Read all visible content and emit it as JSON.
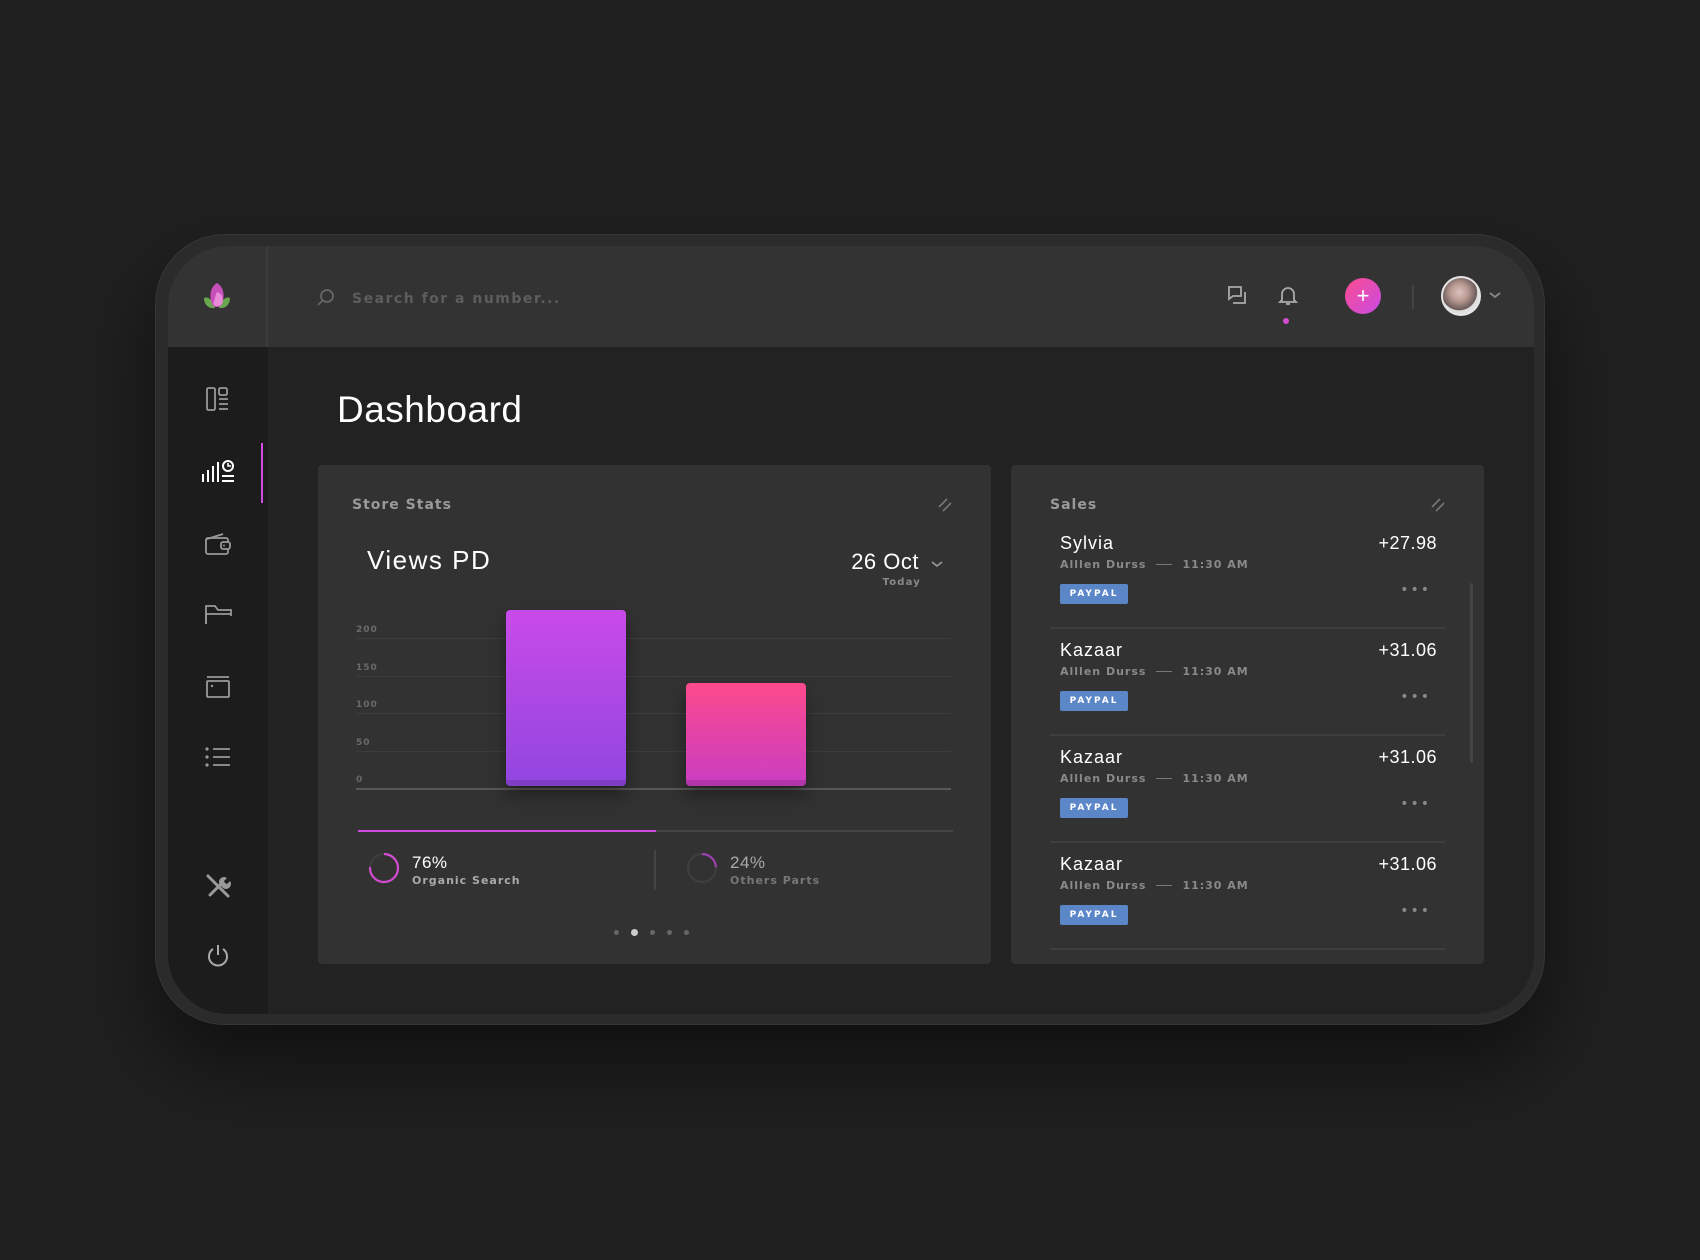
{
  "app": {
    "brand_icon": "lotus-bud-logo"
  },
  "header": {
    "search": {
      "placeholder": "Search for a number...",
      "value": ""
    },
    "icons": [
      "search-icon",
      "messages-icon",
      "bell-icon",
      "plus-icon",
      "avatar",
      "chevron-down-icon"
    ],
    "add_label": "+",
    "notification_dot_color": "#d54bd2"
  },
  "sidebar": {
    "items": [
      {
        "icon": "layout-icon",
        "active": false
      },
      {
        "icon": "analytics-icon",
        "active": true
      },
      {
        "icon": "wallet-icon",
        "active": false
      },
      {
        "icon": "folder-icon",
        "active": false
      },
      {
        "icon": "browser-window-icon",
        "active": false
      },
      {
        "icon": "list-icon",
        "active": false
      },
      {
        "icon": "tools-icon",
        "active": false
      },
      {
        "icon": "power-icon",
        "active": false
      }
    ],
    "accent": "#d04be0"
  },
  "page": {
    "title": "Dashboard"
  },
  "store_stats": {
    "title": "Store Stats",
    "metric": "Views PD",
    "date": "26 Oct",
    "date_sub": "Today",
    "progress_fraction": 0.5,
    "stats": [
      {
        "value": "76%",
        "label": "Organic Search",
        "fraction": 0.76,
        "color": "#d54bd2"
      },
      {
        "value": "24%",
        "label": "Others Parts",
        "fraction": 0.24,
        "color": "#9c3fb0"
      }
    ],
    "pagination": {
      "count": 5,
      "active": 1
    }
  },
  "chart_data": {
    "type": "bar",
    "title": "Views PD",
    "categories": [
      "Organic Search",
      "Others Parts"
    ],
    "values": [
      235,
      138
    ],
    "colors": [
      [
        "#c94ae8",
        "#9146e0"
      ],
      [
        "#fd4a8c",
        "#c93dc3"
      ]
    ],
    "yticks": [
      0,
      50,
      100,
      150,
      200
    ],
    "ylim": [
      0,
      200
    ],
    "xlabel": "",
    "ylabel": "",
    "grid": true
  },
  "sales": {
    "title": "Sales",
    "items": [
      {
        "name": "Sylvia",
        "amount": "+27.98",
        "customer": "Alllen Durss",
        "time": "11:30 AM",
        "method": "PAYPAL"
      },
      {
        "name": "Kazaar",
        "amount": "+31.06",
        "customer": "Alllen Durss",
        "time": "11:30 AM",
        "method": "PAYPAL"
      },
      {
        "name": "Kazaar",
        "amount": "+31.06",
        "customer": "Alllen Durss",
        "time": "11:30 AM",
        "method": "PAYPAL"
      },
      {
        "name": "Kazaar",
        "amount": "+31.06",
        "customer": "Alllen Durss",
        "time": "11:30 AM",
        "method": "PAYPAL"
      }
    ],
    "more_label": "•••"
  }
}
